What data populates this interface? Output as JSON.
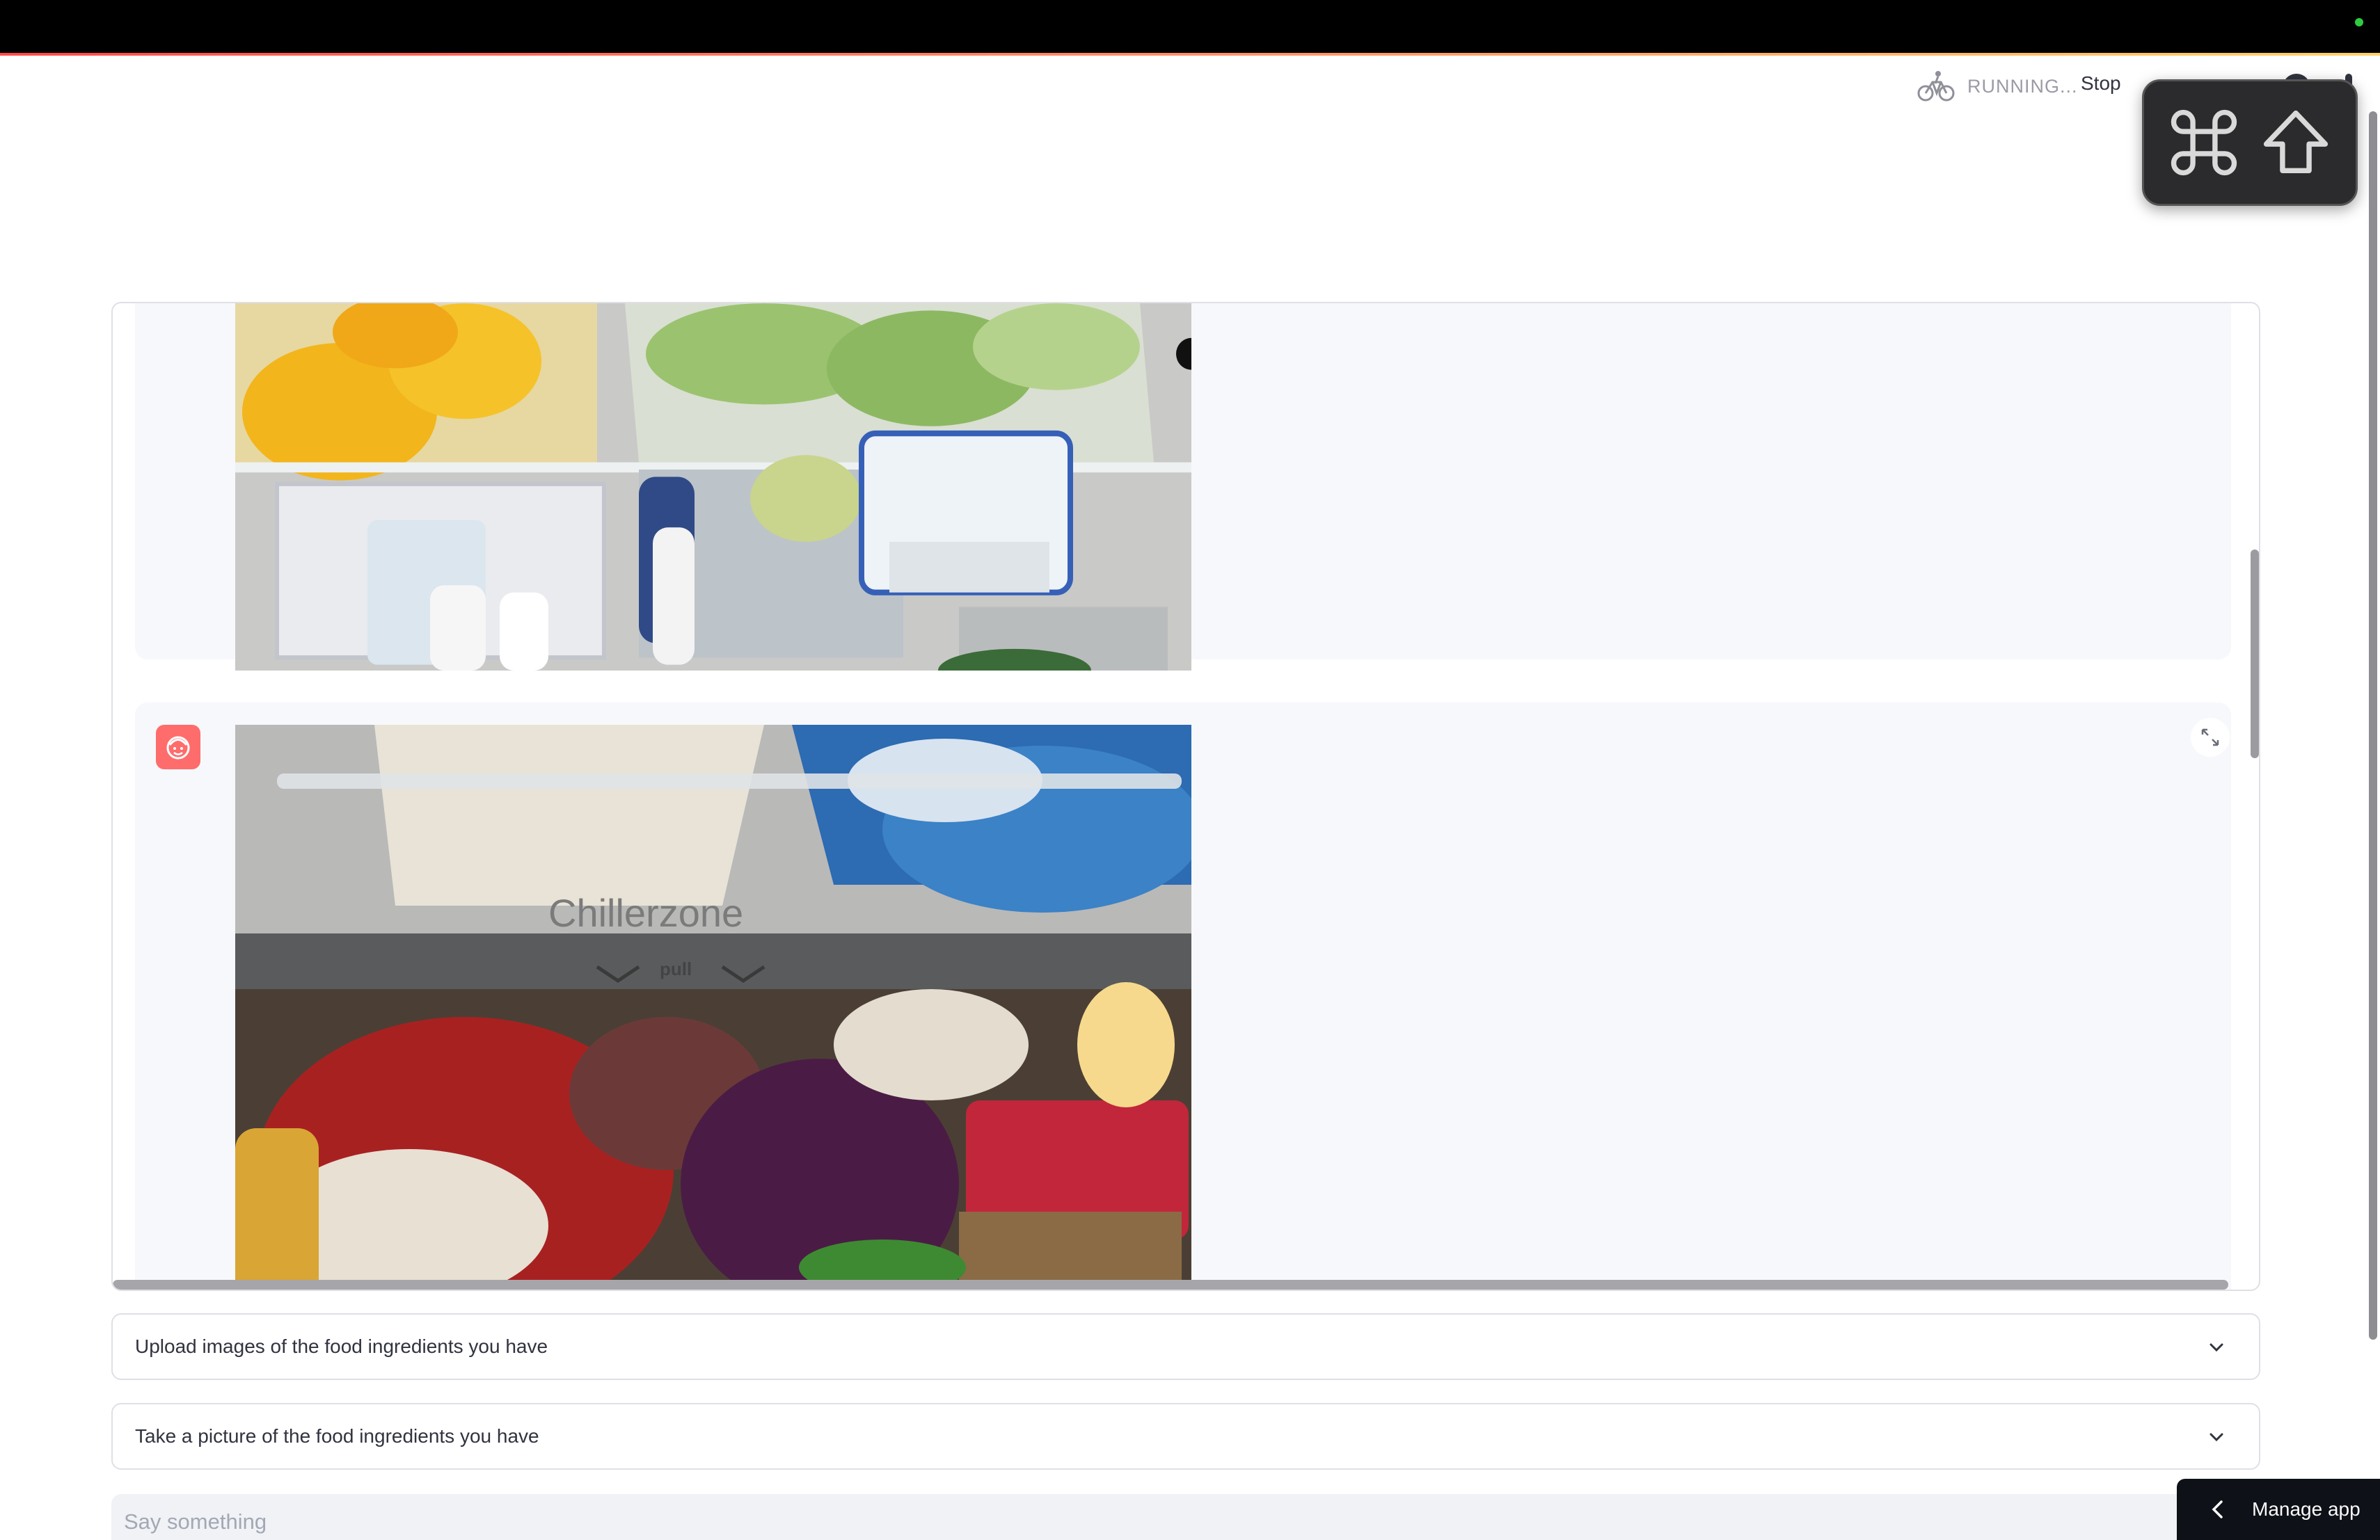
{
  "toolbar": {
    "status_text": "RUNNING...",
    "stop_label": "Stop",
    "status_icon": "bicycle-icon"
  },
  "keyboard_overlay": {
    "keys": [
      "command-key-icon",
      "shift-key-icon"
    ]
  },
  "chat": {
    "messages": [
      {
        "role": "user",
        "content_type": "image",
        "image": "fridge-drawers-photo"
      },
      {
        "role": "user",
        "content_type": "image",
        "image": "fridge-chiller-crisper-photo",
        "avatar": "user-face-icon"
      }
    ],
    "photo_text": {
      "chiller_label": "Chillerzone",
      "pull_label": "pull"
    }
  },
  "expanders": {
    "upload": {
      "label": "Upload images of the food ingredients you have"
    },
    "camera": {
      "label": "Take a picture of the food ingredients you have"
    }
  },
  "chat_input": {
    "placeholder": "Say something"
  },
  "manage_app": {
    "label": "Manage app"
  },
  "colors": {
    "accent": "#ff4b4b",
    "avatar_bg": "#ff6c6c",
    "message_bg": "#f7f8fb",
    "input_bg": "#f0f2f6",
    "manage_bg": "#0e1117"
  }
}
